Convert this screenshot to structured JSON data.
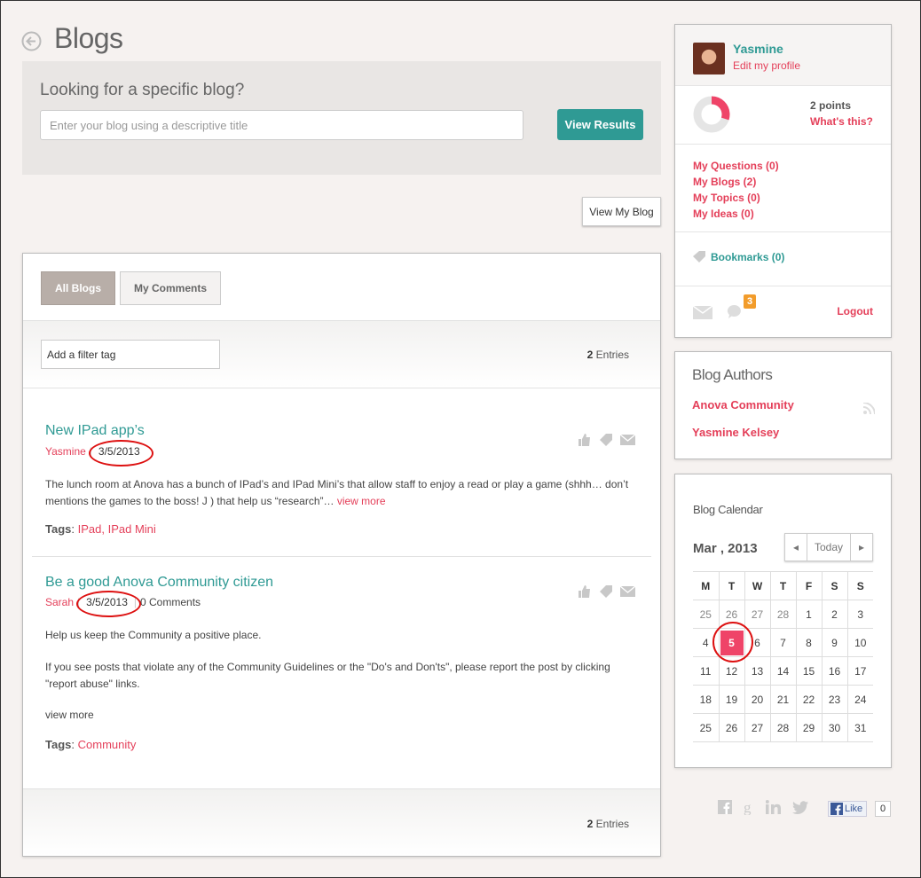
{
  "header": {
    "title": "Blogs"
  },
  "search": {
    "heading": "Looking for a specific blog?",
    "placeholder": "Enter your blog using a descriptive title",
    "button_label": "View Results"
  },
  "view_my_blog_label": "View My Blog",
  "tabs": [
    {
      "label": "All Blogs",
      "active": true
    },
    {
      "label": "My Comments",
      "active": false
    }
  ],
  "filter": {
    "placeholder": "Add a filter tag"
  },
  "entries": {
    "count": "2",
    "label": "Entries"
  },
  "posts": [
    {
      "title": "New IPad app’s",
      "author": "Yasmine",
      "date": "3/5/2013",
      "comments": "",
      "body": [
        "The lunch room at Anova has a bunch of IPad’s and IPad Mini’s that allow staff to enjoy a read or play a game (shhh… don’t mentions the games to the boss! J ) that help us “research”…"
      ],
      "inline_more": "view more",
      "tags_label": "Tags",
      "tags": [
        "IPad",
        "IPad Mini"
      ]
    },
    {
      "title": "Be a good Anova Community citizen",
      "author": "Sarah",
      "date": "3/5/2013",
      "comments": "0 Comments",
      "body": [
        "Help us keep the Community a positive place.",
        "If you see posts that violate any of the Community Guidelines or the \"Do's and Don'ts\", please report the post by clicking \"report abuse\" links."
      ],
      "more": "view more",
      "tags_label": "Tags",
      "tags": [
        "Community"
      ]
    }
  ],
  "profile": {
    "name": "Yasmine",
    "edit": "Edit my profile",
    "points": "2 points",
    "points_fraction": 0.3,
    "whats_this": "What's this?",
    "links": [
      "My Questions (0)",
      "My Blogs (2)",
      "My Topics (0)",
      "My Ideas (0)"
    ],
    "bookmarks": "Bookmarks (0)",
    "notification_count": "3",
    "logout": "Logout"
  },
  "authors": {
    "heading": "Blog Authors",
    "items": [
      "Anova Community",
      "Yasmine Kelsey"
    ]
  },
  "calendar": {
    "heading": "Blog Calendar",
    "month": "Mar , 2013",
    "today_label": "Today",
    "weekdays": [
      "M",
      "T",
      "W",
      "T",
      "F",
      "S",
      "S"
    ],
    "weeks": [
      [
        "25",
        "26",
        "27",
        "28",
        "1",
        "2",
        "3"
      ],
      [
        "4",
        "5",
        "6",
        "7",
        "8",
        "9",
        "10"
      ],
      [
        "11",
        "12",
        "13",
        "14",
        "15",
        "16",
        "17"
      ],
      [
        "18",
        "19",
        "20",
        "21",
        "22",
        "23",
        "24"
      ],
      [
        "25",
        "26",
        "27",
        "28",
        "29",
        "30",
        "31"
      ]
    ],
    "muted_days": 4,
    "selected": "5"
  },
  "social": {
    "like_label": "Like",
    "like_count": "0"
  },
  "colors": {
    "accent": "#e43f59",
    "teal": "#2f9a94",
    "badge": "#f29c2b"
  }
}
